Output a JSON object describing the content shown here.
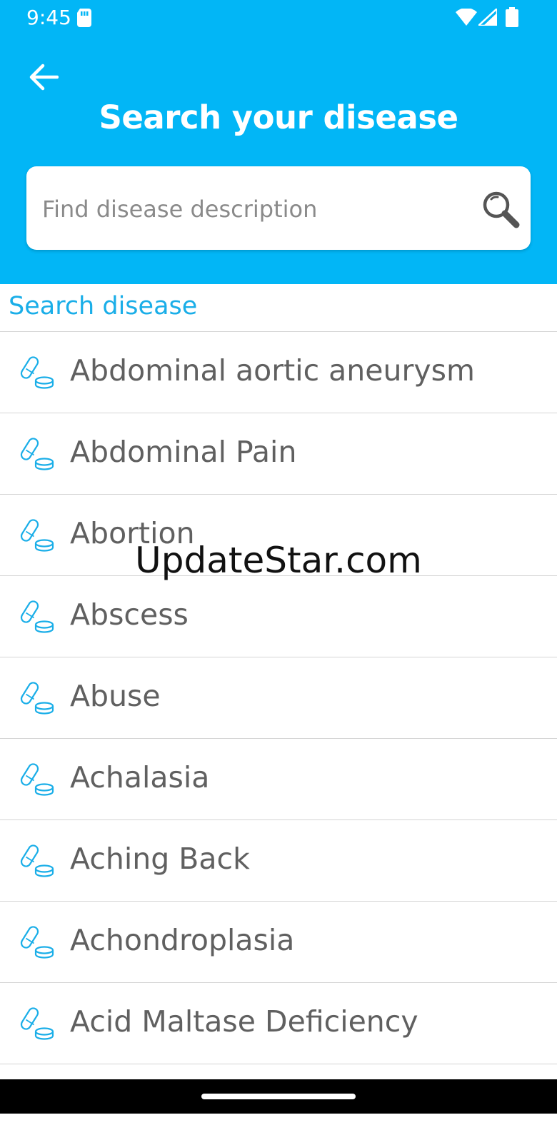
{
  "status_bar": {
    "time": "9:45",
    "icons": [
      "sim-card-icon",
      "wifi-icon",
      "cell-signal-icon",
      "battery-icon"
    ]
  },
  "header": {
    "title": "Search your disease",
    "back_icon": "arrow-left-icon",
    "color": "#02b6f6"
  },
  "search": {
    "placeholder": "Find disease description",
    "value": "",
    "icon": "search-icon"
  },
  "section_label": "Search disease",
  "list": {
    "item_icon": "pill-icon",
    "items": [
      {
        "label": "Abdominal aortic aneurysm"
      },
      {
        "label": "Abdominal Pain"
      },
      {
        "label": "Abortion"
      },
      {
        "label": "Abscess"
      },
      {
        "label": "Abuse"
      },
      {
        "label": "Achalasia"
      },
      {
        "label": "Aching Back"
      },
      {
        "label": "Achondroplasia"
      },
      {
        "label": "Acid Maltase Deficiency"
      }
    ]
  },
  "watermark": "UpdateStar.com",
  "colors": {
    "accent": "#02b6f6",
    "section_label": "#1aaee8",
    "item_text": "#606060"
  }
}
